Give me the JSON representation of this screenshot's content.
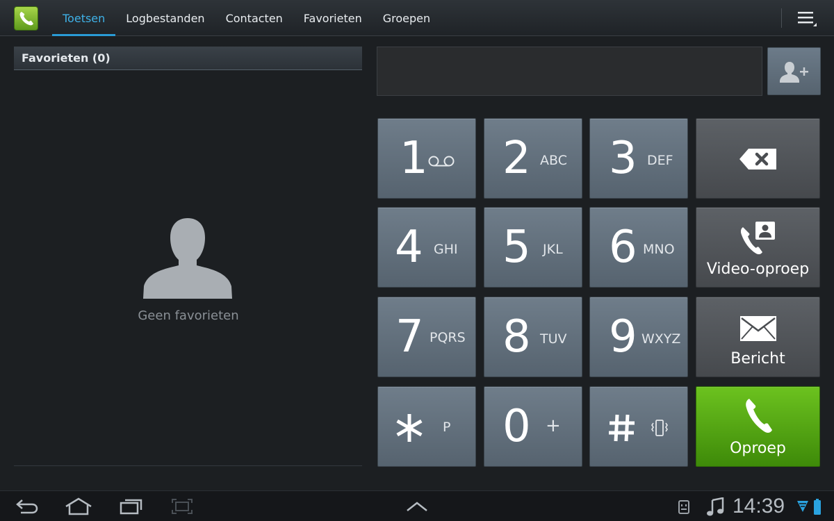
{
  "tabs": [
    {
      "label": "Toetsen",
      "active": true
    },
    {
      "label": "Logbestanden",
      "active": false
    },
    {
      "label": "Contacten",
      "active": false
    },
    {
      "label": "Favorieten",
      "active": false
    },
    {
      "label": "Groepen",
      "active": false
    }
  ],
  "favorites": {
    "header": "Favorieten (0)",
    "empty_text": "Geen favorieten"
  },
  "dialer": {
    "number": "",
    "keys": [
      {
        "digit": "1",
        "letters": "",
        "icon": "voicemail-icon"
      },
      {
        "digit": "2",
        "letters": "ABC"
      },
      {
        "digit": "3",
        "letters": "DEF"
      },
      {
        "digit": "4",
        "letters": "GHI"
      },
      {
        "digit": "5",
        "letters": "JKL"
      },
      {
        "digit": "6",
        "letters": "MNO"
      },
      {
        "digit": "7",
        "letters": "PQRS"
      },
      {
        "digit": "8",
        "letters": "TUV"
      },
      {
        "digit": "9",
        "letters": "WXYZ"
      },
      {
        "digit": "*",
        "letters": "P"
      },
      {
        "digit": "0",
        "letters": "+"
      },
      {
        "digit": "#",
        "letters": "",
        "icon": "vibrate-icon"
      }
    ],
    "actions": {
      "video_call": "Video-oproep",
      "message": "Bericht",
      "call": "Oproep"
    }
  },
  "status": {
    "time": "14:39"
  },
  "colors": {
    "accent": "#2a9bd6",
    "call_green": "#52a814",
    "key_blue_grey": "#64717e",
    "action_grey": "#525559"
  }
}
